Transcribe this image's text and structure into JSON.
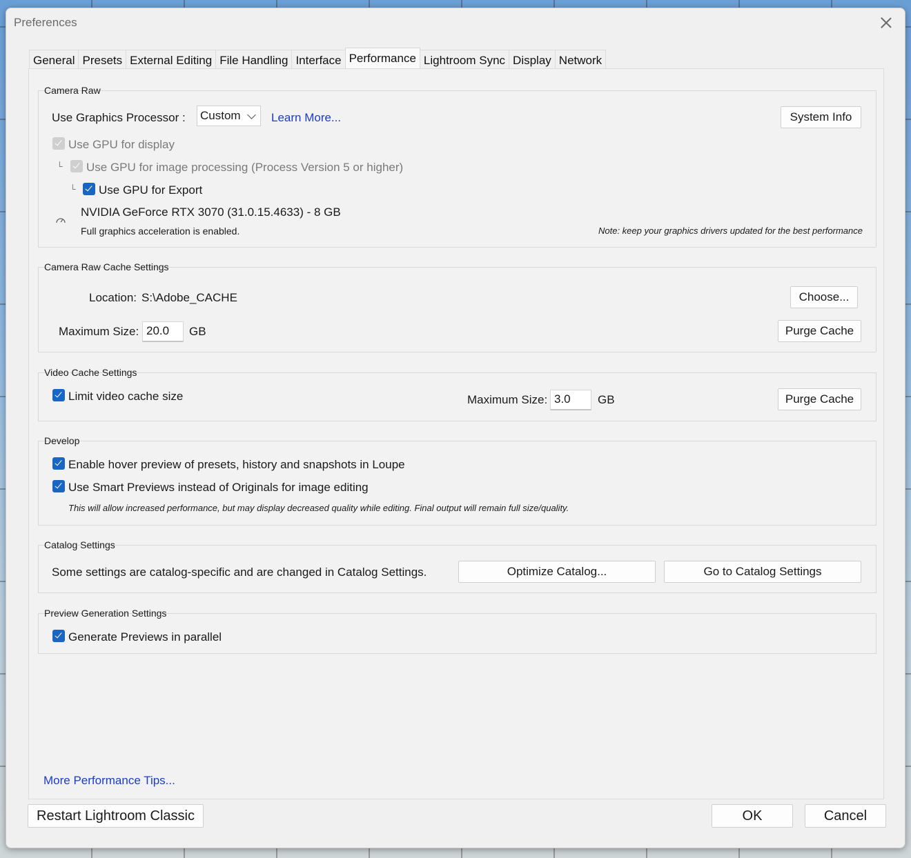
{
  "window": {
    "title": "Preferences"
  },
  "tabs": [
    {
      "label": "General"
    },
    {
      "label": "Presets"
    },
    {
      "label": "External Editing"
    },
    {
      "label": "File Handling"
    },
    {
      "label": "Interface"
    },
    {
      "label": "Performance"
    },
    {
      "label": "Lightroom Sync"
    },
    {
      "label": "Display"
    },
    {
      "label": "Network"
    }
  ],
  "active_tab": "Performance",
  "camera_raw": {
    "title": "Camera Raw",
    "gpu_label": "Use Graphics Processor :",
    "gpu_value": "Custom",
    "learn_more": "Learn More...",
    "system_info": "System Info",
    "gpu_display": {
      "label": "Use GPU for display",
      "checked": true,
      "disabled": true
    },
    "gpu_processing": {
      "label": "Use GPU for image processing (Process Version 5 or higher)",
      "checked": true,
      "disabled": true
    },
    "gpu_export": {
      "label": "Use GPU for Export",
      "checked": true,
      "disabled": false
    },
    "gpu_name": "NVIDIA GeForce RTX 3070 (31.0.15.4633) - 8 GB",
    "accel_status": "Full graphics acceleration is enabled.",
    "driver_note": "Note: keep your graphics drivers updated for the best performance",
    "tree_marker": "└"
  },
  "cache": {
    "title": "Camera Raw Cache Settings",
    "location_label": "Location:",
    "location_value": "S:\\Adobe_CACHE",
    "choose": "Choose...",
    "max_label": "Maximum Size:",
    "max_value": "20.0",
    "unit": "GB",
    "purge": "Purge Cache"
  },
  "video_cache": {
    "title": "Video Cache Settings",
    "limit_label": "Limit video cache size",
    "limit_checked": true,
    "max_label": "Maximum Size:",
    "max_value": "3.0",
    "unit": "GB",
    "purge": "Purge Cache"
  },
  "develop": {
    "title": "Develop",
    "hover_preview": "Enable hover preview of presets, history and snapshots in Loupe",
    "smart_previews": "Use Smart Previews instead of Originals for image editing",
    "note": "This will allow increased performance, but may display decreased quality while editing. Final output will remain full size/quality."
  },
  "catalog": {
    "title": "Catalog Settings",
    "text": "Some settings are catalog-specific and are changed in Catalog Settings.",
    "optimize": "Optimize Catalog...",
    "goto": "Go to Catalog Settings"
  },
  "preview_gen": {
    "title": "Preview Generation Settings",
    "parallel": "Generate Previews in parallel"
  },
  "more_tips": "More Performance Tips...",
  "footer": {
    "restart": "Restart Lightroom Classic",
    "ok": "OK",
    "cancel": "Cancel"
  }
}
